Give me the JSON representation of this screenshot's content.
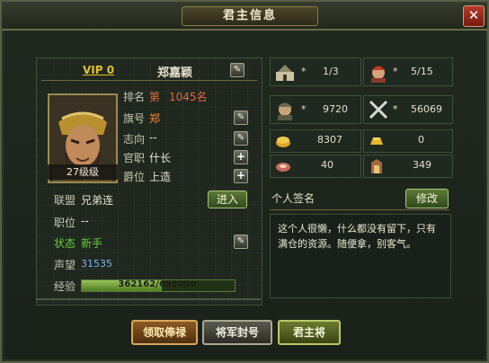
{
  "window": {
    "title": "君主信息",
    "close_label": "✕"
  },
  "profile": {
    "vip": "VIP 0",
    "name": "郑嘉颖",
    "level": "27级级"
  },
  "fields": {
    "rank_label": "排名",
    "rank_prefix": "第",
    "rank_value": "1045名",
    "flag_label": "旗号",
    "flag_value": "郑",
    "ambition_label": "志向",
    "ambition_value": "--",
    "office_label": "官职",
    "office_value": "什长",
    "title_label": "爵位",
    "title_value": "上造",
    "alliance_label": "联盟",
    "alliance_value": "兄弟连",
    "enter_label": "进入",
    "position_label": "职位",
    "position_value": "--",
    "status_label": "状态",
    "status_value": "新手",
    "prestige_label": "声望",
    "prestige_value": "31535",
    "exp_label": "经验",
    "exp_text": "362162/693000",
    "exp_current": 362162,
    "exp_max": 693000
  },
  "stats": {
    "cities": "1/3",
    "generals": "5/15",
    "population": "9720",
    "troops": "56069",
    "star": "*",
    "copper": "8307",
    "gold": "0",
    "food": "40",
    "honor": "349"
  },
  "signature": {
    "title": "个人签名",
    "modify_label": "修改",
    "text": "这个人很懒，什么都没有留下，只有满仓的资源。随便拿，别客气。"
  },
  "bottom_buttons": {
    "collect": "领取俸禄",
    "general_title": "将军封号",
    "lord_general": "君主将"
  },
  "colors": {
    "accent_gold": "#e0c22e",
    "rank_red": "#e36a3a",
    "status_green": "#6acd3a",
    "prestige_blue": "#7eb2e8"
  }
}
